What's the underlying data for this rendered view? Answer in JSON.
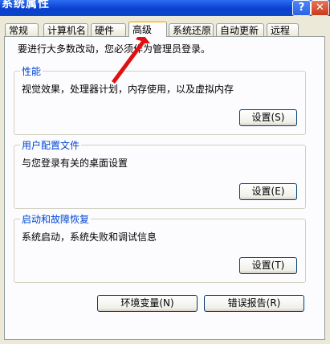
{
  "window": {
    "title": "系统属性",
    "help_glyph": "?",
    "close_glyph": "✕"
  },
  "tabs": [
    "常规",
    "计算机名",
    "硬件",
    "高级",
    "系统还原",
    "自动更新",
    "远程"
  ],
  "active_tab": "高级",
  "warning": "要进行大多数改动，您必须作为管理员登录。",
  "groups": {
    "performance": {
      "title": "性能",
      "desc": "视觉效果，处理器计划，内存使用，以及虚拟内存",
      "button": "设置(S)"
    },
    "profiles": {
      "title": "用户配置文件",
      "desc": "与您登录有关的桌面设置",
      "button": "设置(E)"
    },
    "startup": {
      "title": "启动和故障恢复",
      "desc": "系统启动，系统失败和调试信息",
      "button": "设置(T)"
    }
  },
  "bottom": {
    "env_button": "环境变量(N)",
    "error_button": "错误报告(R)"
  },
  "annotation_color": "#e01010"
}
